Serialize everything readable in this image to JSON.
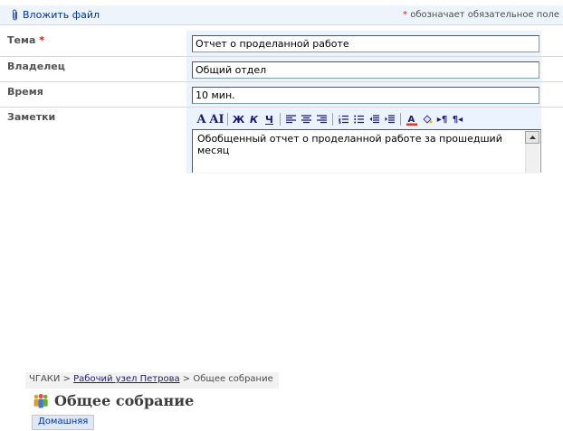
{
  "toolbar": {
    "attach_label": "Вложить файл",
    "required_star": "*",
    "required_note": " обозначает обязательное поле"
  },
  "form": {
    "fields": [
      {
        "label": "Тема",
        "required": "*",
        "value": "Отчет о проделанной работе"
      },
      {
        "label": "Владелец",
        "value": "Общий отдел"
      },
      {
        "label": "Время",
        "value": "10 мин."
      },
      {
        "label": "Заметки",
        "value": "Обобщенный отчет о проделанной работе за прошедший месяц"
      }
    ]
  },
  "rte_toolbar": {
    "font": "A",
    "font_size": "AI",
    "bold": "Ж",
    "italic": "К",
    "underline": "Ч",
    "ltr": "▸¶",
    "rtl": "¶◂"
  },
  "breadcrumb": {
    "root": "ЧГАКИ",
    "sep1": " > ",
    "middle": "Рабочий узел Петрова",
    "sep2": " > ",
    "current": "Общее собрание"
  },
  "page": {
    "title": "Общее собрание",
    "home_tab": "Домашняя"
  },
  "colors": {
    "link": "#003399",
    "required": "#ff0000",
    "field_bg": "#ebf3ff"
  }
}
